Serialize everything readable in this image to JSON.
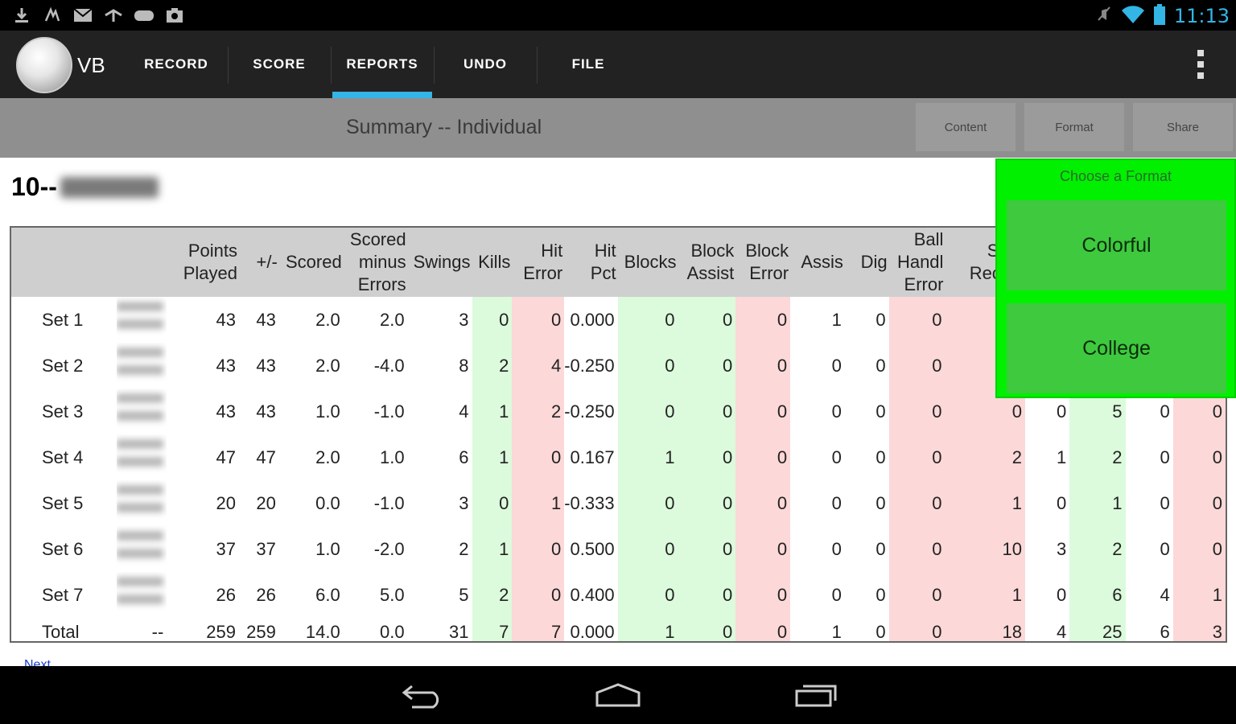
{
  "status_bar": {
    "time": "11:13",
    "left_icons": [
      "download-icon",
      "signal-notify-icon",
      "mail-icon",
      "arrows-icon",
      "gamepad-icon",
      "camera-icon"
    ],
    "right_icons": [
      "mute-icon",
      "wifi-icon",
      "battery-icon"
    ]
  },
  "app": {
    "logo_text": "VB",
    "tabs": [
      "RECORD",
      "SCORE",
      "REPORTS",
      "UNDO",
      "FILE"
    ],
    "active_tab": "REPORTS"
  },
  "sub_header": {
    "title": "Summary -- Individual",
    "buttons": [
      "Content",
      "Format",
      "Share"
    ]
  },
  "player": {
    "number_prefix": "10--"
  },
  "format_popup": {
    "title": "Choose a Format",
    "options": [
      "Colorful",
      "College"
    ]
  },
  "table": {
    "headers": [
      "",
      "",
      "Points Played",
      "+/-",
      "Scored",
      "Scored minus Errors",
      "Swings",
      "Kills",
      "Hit Error",
      "Hit Pct",
      "Blocks",
      "Block Assist",
      "Block Error",
      "Assis",
      "Dig",
      "Ball Handl Error",
      "Serv Receiv",
      "",
      "",
      "",
      ""
    ],
    "rows": [
      {
        "label": "Set 1",
        "values": [
          "43",
          "43",
          "2.0",
          "2.0",
          "3",
          "0",
          "0",
          "0.000",
          "0",
          "0",
          "0",
          "1",
          "0",
          "0",
          "",
          "",
          "",
          "",
          ""
        ]
      },
      {
        "label": "Set 2",
        "values": [
          "43",
          "43",
          "2.0",
          "-4.0",
          "8",
          "2",
          "4",
          "-0.250",
          "0",
          "0",
          "0",
          "0",
          "0",
          "0",
          "",
          "",
          "",
          "",
          ""
        ]
      },
      {
        "label": "Set 3",
        "values": [
          "43",
          "43",
          "1.0",
          "-1.0",
          "4",
          "1",
          "2",
          "-0.250",
          "0",
          "0",
          "0",
          "0",
          "0",
          "0",
          "0",
          "0",
          "5",
          "0",
          "0"
        ]
      },
      {
        "label": "Set 4",
        "values": [
          "47",
          "47",
          "2.0",
          "1.0",
          "6",
          "1",
          "0",
          "0.167",
          "1",
          "0",
          "0",
          "0",
          "0",
          "0",
          "2",
          "1",
          "2",
          "0",
          "0"
        ]
      },
      {
        "label": "Set 5",
        "values": [
          "20",
          "20",
          "0.0",
          "-1.0",
          "3",
          "0",
          "1",
          "-0.333",
          "0",
          "0",
          "0",
          "0",
          "0",
          "0",
          "1",
          "0",
          "1",
          "0",
          "0"
        ]
      },
      {
        "label": "Set 6",
        "values": [
          "37",
          "37",
          "1.0",
          "-2.0",
          "2",
          "1",
          "0",
          "0.500",
          "0",
          "0",
          "0",
          "0",
          "0",
          "0",
          "10",
          "3",
          "2",
          "0",
          "0"
        ]
      },
      {
        "label": "Set 7",
        "values": [
          "26",
          "26",
          "6.0",
          "5.0",
          "5",
          "2",
          "0",
          "0.400",
          "0",
          "0",
          "0",
          "0",
          "0",
          "0",
          "1",
          "0",
          "6",
          "4",
          "1"
        ]
      }
    ],
    "total": {
      "label": "Total",
      "values": [
        "--",
        "259",
        "259",
        "14.0",
        "0.0",
        "31",
        "7",
        "7",
        "0.000",
        "1",
        "0",
        "0",
        "1",
        "0",
        "0",
        "18",
        "4",
        "25",
        "6",
        "3"
      ]
    }
  },
  "next_link": "Next",
  "nav_bar": [
    "back-icon",
    "home-icon",
    "recents-icon"
  ],
  "colors": {
    "accent": "#33b5e5",
    "popup_bg": "#00f000",
    "popup_option": "#3ec93e",
    "cell_green": "#dcfadc",
    "cell_red": "#fcd8d8"
  }
}
